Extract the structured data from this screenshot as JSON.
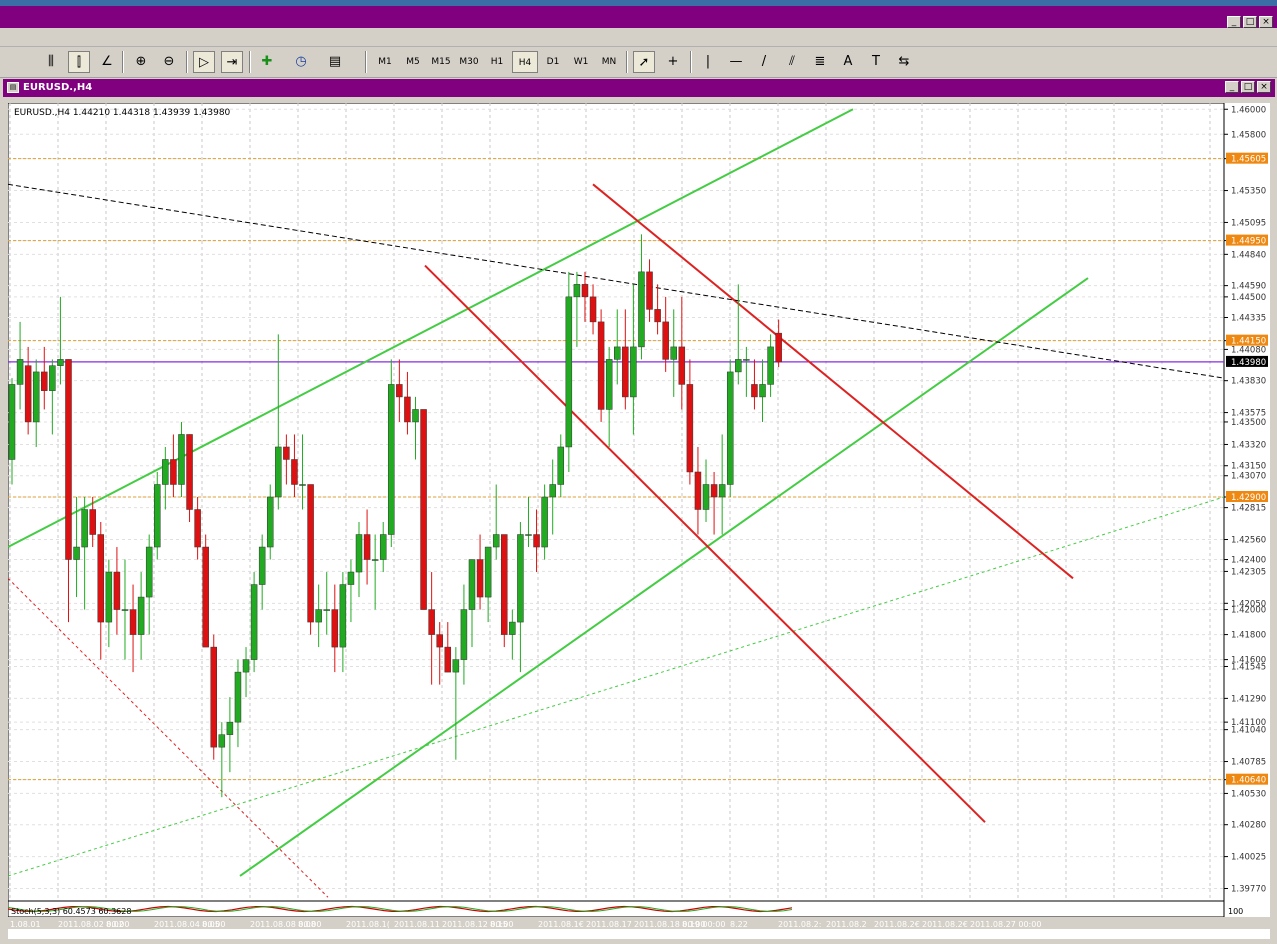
{
  "window": {
    "controls": [
      "_",
      "□",
      "×"
    ]
  },
  "toolbar": {
    "timeframes": [
      "M1",
      "M5",
      "M15",
      "M30",
      "H1",
      "H4",
      "D1",
      "W1",
      "MN"
    ],
    "active_timeframe": "H4",
    "tools": [
      "A"
    ]
  },
  "chart_window": {
    "title": "EURUSD.,H4",
    "controls": [
      "_",
      "□",
      "×"
    ]
  },
  "chart_data": {
    "type": "candlestick",
    "symbol_header": "EURUSD.,H4  1.44210 1.44318 1.43939 1.43980",
    "y_range": [
      1.3967,
      1.4605
    ],
    "y_ticks": [
      "1.46000",
      "1.45800",
      "1.45605",
      "1.45350",
      "1.45095",
      "1.44950",
      "1.44840",
      "1.44590",
      "1.44500",
      "1.44335",
      "1.44150",
      "1.44080",
      "1.43830",
      "1.43575",
      "1.43500",
      "1.43320",
      "1.43150",
      "1.43070",
      "1.42900",
      "1.42815",
      "1.42560",
      "1.42400",
      "1.42305",
      "1.42050",
      "1.42000",
      "1.41800",
      "1.41600",
      "1.41545",
      "1.41290",
      "1.41100",
      "1.41040",
      "1.40785",
      "1.40640",
      "1.40530",
      "1.40280",
      "1.40025",
      "1.39770"
    ],
    "tick_values": [
      1.46,
      1.458,
      1.45605,
      1.4535,
      1.45095,
      1.4495,
      1.4484,
      1.4459,
      1.445,
      1.44335,
      1.4415,
      1.4408,
      1.4383,
      1.43575,
      1.435,
      1.4332,
      1.4315,
      1.4307,
      1.429,
      1.42815,
      1.4256,
      1.424,
      1.42305,
      1.4205,
      1.42,
      1.418,
      1.416,
      1.41545,
      1.4129,
      1.411,
      1.4104,
      1.40785,
      1.4064,
      1.4053,
      1.4028,
      1.40025,
      1.3977
    ],
    "highlighted_ticks": [
      {
        "label": "1.45605",
        "value": 1.45605
      },
      {
        "label": "1.44950",
        "value": 1.4495
      },
      {
        "label": "1.44150",
        "value": 1.4415
      },
      {
        "label": "1.42900",
        "value": 1.429
      },
      {
        "label": "1.40640",
        "value": 1.4064
      }
    ],
    "current_price": {
      "label": "1.43980",
      "value": 1.4398
    },
    "x_labels": [
      "1.08.01",
      "2011.08.02 00:00",
      "8.02",
      "2011.08.04 00:00",
      "8.05",
      "2011.08.08 00:00",
      "8.08",
      "2011.08.1(",
      "2011.08.11",
      "2011.08.12 00:00",
      "8.15",
      "2011.08.1€",
      "2011.08.17",
      "2011.08.18 00:00",
      "8.19 00:00",
      "8.22",
      "2011.08.2:",
      "2011.08.2",
      "2011.08.2€",
      "2011.08.2€",
      "2011.08.27 00:00"
    ],
    "candles": [
      [
        1.432,
        1.4385,
        1.43,
        1.438
      ],
      [
        1.438,
        1.443,
        1.436,
        1.44
      ],
      [
        1.4395,
        1.441,
        1.434,
        1.435
      ],
      [
        1.435,
        1.44,
        1.433,
        1.439
      ],
      [
        1.439,
        1.441,
        1.436,
        1.4375
      ],
      [
        1.4375,
        1.44,
        1.434,
        1.4395
      ],
      [
        1.4395,
        1.445,
        1.438,
        1.44
      ],
      [
        1.44,
        1.44,
        1.419,
        1.424
      ],
      [
        1.424,
        1.429,
        1.421,
        1.425
      ],
      [
        1.425,
        1.429,
        1.42,
        1.428
      ],
      [
        1.428,
        1.429,
        1.425,
        1.426
      ],
      [
        1.426,
        1.427,
        1.416,
        1.419
      ],
      [
        1.419,
        1.424,
        1.417,
        1.423
      ],
      [
        1.423,
        1.425,
        1.418,
        1.42
      ],
      [
        1.42,
        1.424,
        1.416,
        1.42
      ],
      [
        1.42,
        1.422,
        1.415,
        1.418
      ],
      [
        1.418,
        1.423,
        1.416,
        1.421
      ],
      [
        1.421,
        1.426,
        1.418,
        1.425
      ],
      [
        1.425,
        1.431,
        1.424,
        1.43
      ],
      [
        1.43,
        1.433,
        1.428,
        1.432
      ],
      [
        1.432,
        1.434,
        1.429,
        1.43
      ],
      [
        1.43,
        1.435,
        1.429,
        1.434
      ],
      [
        1.434,
        1.434,
        1.427,
        1.428
      ],
      [
        1.428,
        1.429,
        1.424,
        1.425
      ],
      [
        1.425,
        1.426,
        1.418,
        1.417
      ],
      [
        1.417,
        1.418,
        1.408,
        1.409
      ],
      [
        1.409,
        1.411,
        1.405,
        1.41
      ],
      [
        1.41,
        1.413,
        1.407,
        1.411
      ],
      [
        1.411,
        1.416,
        1.409,
        1.415
      ],
      [
        1.415,
        1.417,
        1.413,
        1.416
      ],
      [
        1.416,
        1.423,
        1.415,
        1.422
      ],
      [
        1.422,
        1.426,
        1.42,
        1.425
      ],
      [
        1.425,
        1.43,
        1.424,
        1.429
      ],
      [
        1.429,
        1.442,
        1.428,
        1.433
      ],
      [
        1.433,
        1.434,
        1.43,
        1.432
      ],
      [
        1.432,
        1.434,
        1.429,
        1.43
      ],
      [
        1.43,
        1.434,
        1.428,
        1.43
      ],
      [
        1.43,
        1.43,
        1.418,
        1.419
      ],
      [
        1.419,
        1.422,
        1.417,
        1.42
      ],
      [
        1.42,
        1.423,
        1.418,
        1.42
      ],
      [
        1.42,
        1.422,
        1.415,
        1.417
      ],
      [
        1.417,
        1.423,
        1.415,
        1.422
      ],
      [
        1.422,
        1.424,
        1.419,
        1.423
      ],
      [
        1.423,
        1.427,
        1.421,
        1.426
      ],
      [
        1.426,
        1.428,
        1.422,
        1.424
      ],
      [
        1.424,
        1.426,
        1.42,
        1.424
      ],
      [
        1.424,
        1.427,
        1.423,
        1.426
      ],
      [
        1.426,
        1.44,
        1.425,
        1.438
      ],
      [
        1.438,
        1.44,
        1.435,
        1.437
      ],
      [
        1.437,
        1.439,
        1.434,
        1.435
      ],
      [
        1.435,
        1.437,
        1.432,
        1.436
      ],
      [
        1.436,
        1.436,
        1.422,
        1.42
      ],
      [
        1.42,
        1.423,
        1.414,
        1.418
      ],
      [
        1.418,
        1.419,
        1.414,
        1.417
      ],
      [
        1.417,
        1.419,
        1.415,
        1.415
      ],
      [
        1.415,
        1.417,
        1.408,
        1.416
      ],
      [
        1.416,
        1.422,
        1.414,
        1.42
      ],
      [
        1.42,
        1.424,
        1.417,
        1.424
      ],
      [
        1.424,
        1.426,
        1.42,
        1.421
      ],
      [
        1.421,
        1.425,
        1.419,
        1.425
      ],
      [
        1.425,
        1.43,
        1.424,
        1.426
      ],
      [
        1.426,
        1.426,
        1.417,
        1.418
      ],
      [
        1.418,
        1.42,
        1.416,
        1.419
      ],
      [
        1.419,
        1.427,
        1.415,
        1.426
      ],
      [
        1.426,
        1.429,
        1.425,
        1.426
      ],
      [
        1.426,
        1.428,
        1.423,
        1.425
      ],
      [
        1.425,
        1.43,
        1.424,
        1.429
      ],
      [
        1.429,
        1.432,
        1.426,
        1.43
      ],
      [
        1.43,
        1.434,
        1.429,
        1.433
      ],
      [
        1.433,
        1.447,
        1.431,
        1.445
      ],
      [
        1.445,
        1.447,
        1.441,
        1.446
      ],
      [
        1.446,
        1.447,
        1.443,
        1.445
      ],
      [
        1.445,
        1.446,
        1.442,
        1.443
      ],
      [
        1.443,
        1.444,
        1.435,
        1.436
      ],
      [
        1.436,
        1.441,
        1.433,
        1.44
      ],
      [
        1.44,
        1.444,
        1.438,
        1.441
      ],
      [
        1.441,
        1.444,
        1.436,
        1.437
      ],
      [
        1.437,
        1.446,
        1.434,
        1.441
      ],
      [
        1.441,
        1.45,
        1.44,
        1.447
      ],
      [
        1.447,
        1.448,
        1.443,
        1.444
      ],
      [
        1.444,
        1.446,
        1.442,
        1.443
      ],
      [
        1.443,
        1.445,
        1.439,
        1.44
      ],
      [
        1.44,
        1.444,
        1.437,
        1.441
      ],
      [
        1.441,
        1.445,
        1.436,
        1.438
      ],
      [
        1.438,
        1.44,
        1.43,
        1.431
      ],
      [
        1.431,
        1.433,
        1.426,
        1.428
      ],
      [
        1.428,
        1.432,
        1.427,
        1.43
      ],
      [
        1.43,
        1.431,
        1.426,
        1.429
      ],
      [
        1.429,
        1.434,
        1.426,
        1.43
      ],
      [
        1.43,
        1.44,
        1.429,
        1.439
      ],
      [
        1.439,
        1.446,
        1.438,
        1.44
      ],
      [
        1.44,
        1.441,
        1.437,
        1.44
      ],
      [
        1.438,
        1.44,
        1.436,
        1.437
      ],
      [
        1.437,
        1.44,
        1.435,
        1.438
      ],
      [
        1.438,
        1.442,
        1.437,
        1.441
      ],
      [
        1.4421,
        1.44318,
        1.43939,
        1.4398
      ]
    ],
    "bull_color": "#22aa22",
    "bear_color": "#dd1111",
    "indicator_label": "Stoch(5,3,3) 60.4573 60.3628",
    "indicator_scale_max": "100"
  }
}
